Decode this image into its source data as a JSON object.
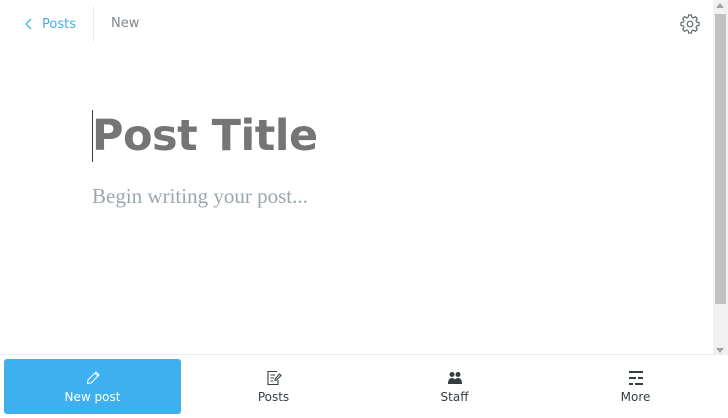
{
  "header": {
    "back_label": "Posts",
    "status": "New"
  },
  "editor": {
    "title_placeholder": "Post Title",
    "body_placeholder": "Begin writing your post..."
  },
  "nav": {
    "items": [
      {
        "label": "New post",
        "icon": "pencil-icon",
        "active": true
      },
      {
        "label": "Posts",
        "icon": "posts-icon",
        "active": false
      },
      {
        "label": "Staff",
        "icon": "staff-icon",
        "active": false
      },
      {
        "label": "More",
        "icon": "more-icon",
        "active": false
      }
    ]
  },
  "colors": {
    "accent": "#3eb0ef",
    "placeholder": "#a7b5bb",
    "text": "#343f44"
  }
}
